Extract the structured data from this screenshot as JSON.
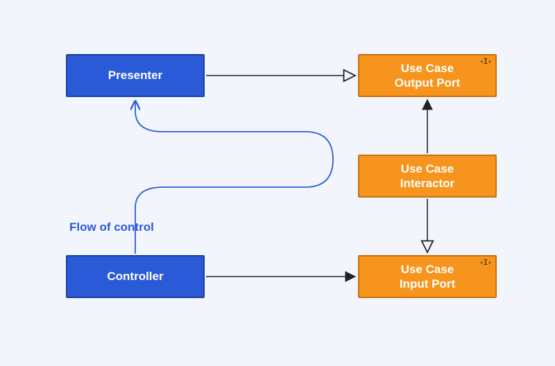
{
  "boxes": {
    "presenter": {
      "label": "Presenter"
    },
    "controller": {
      "label": "Controller"
    },
    "outputPort": {
      "label": "Use Case\nOutput Port"
    },
    "interactor": {
      "label": "Use Case\nInteractor"
    },
    "inputPort": {
      "label": "Use Case\nInput Port"
    }
  },
  "flowLabel": "Flow of control",
  "interfaceGlyph": "‹I›",
  "colors": {
    "blue": "#2a5ad7",
    "orange": "#f7941d",
    "arrow": "#222222"
  },
  "arrows": [
    {
      "from": "presenter",
      "to": "outputPort",
      "style": "open",
      "kind": "implements"
    },
    {
      "from": "controller",
      "to": "inputPort",
      "style": "solid",
      "kind": "uses"
    },
    {
      "from": "interactor",
      "to": "outputPort",
      "style": "solid",
      "kind": "uses"
    },
    {
      "from": "interactor",
      "to": "inputPort",
      "style": "open",
      "kind": "implements"
    }
  ],
  "flowOfControl": [
    "controller",
    "interactor",
    "presenter"
  ]
}
